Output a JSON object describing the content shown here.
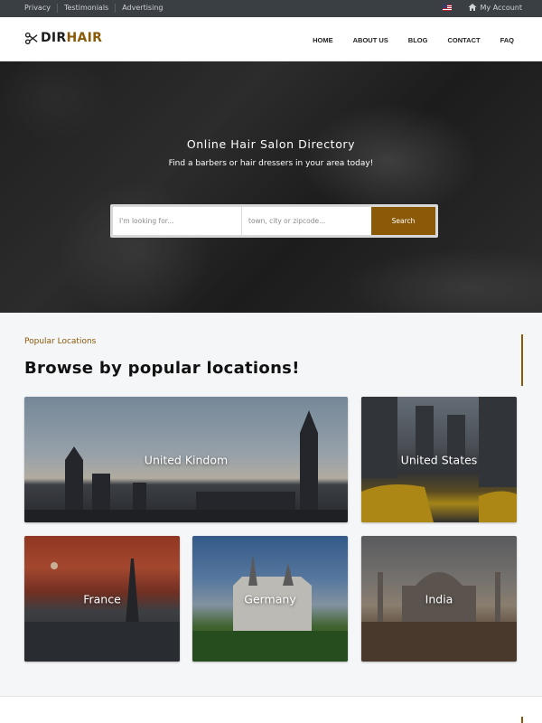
{
  "topbar": {
    "links": [
      "Privacy",
      "Testimonials",
      "Advertising"
    ],
    "account_label": "My Account"
  },
  "header": {
    "logo_part1": "DIR",
    "logo_part2": "HAIR",
    "nav": [
      "HOME",
      "ABOUT US",
      "BLOG",
      "CONTACT",
      "FAQ"
    ]
  },
  "hero": {
    "title": "Online Hair Salon Directory",
    "subtitle": "Find a barbers or hair dressers in your area today!",
    "search_placeholder_1": "I'm looking for...",
    "search_placeholder_2": "town, city or zipcode...",
    "search_button": "Search"
  },
  "locations": {
    "tag": "Popular Locations",
    "title": "Browse by popular locations!",
    "cards": [
      "United Kindom",
      "United States",
      "France",
      "Germany",
      "India"
    ]
  },
  "colors": {
    "accent": "#8a5a08",
    "topbar": "#3a3f44"
  }
}
